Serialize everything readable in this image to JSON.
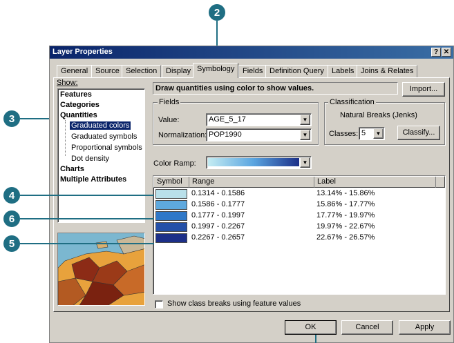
{
  "callouts": {
    "c2": "2",
    "c3": "3",
    "c4": "4",
    "c5": "5",
    "c6": "6"
  },
  "window": {
    "title": "Layer Properties",
    "help_btn": "?",
    "close_btn": "✕"
  },
  "tabs": [
    "General",
    "Source",
    "Selection",
    "Display",
    "Symbology",
    "Fields",
    "Definition Query",
    "Labels",
    "Joins & Relates"
  ],
  "show": {
    "label": "Show:",
    "items": [
      "Features",
      "Categories",
      "Quantities"
    ],
    "sub_items": [
      "Graduated colors",
      "Graduated symbols",
      "Proportional symbols",
      "Dot density"
    ],
    "items_after": [
      "Charts",
      "Multiple Attributes"
    ]
  },
  "heading": "Draw quantities using color to show values.",
  "import_label": "Import...",
  "fields": {
    "group_label": "Fields",
    "value_label": "Value:",
    "value": "AGE_5_17",
    "normalization_label": "Normalization:",
    "normalization": "POP1990"
  },
  "classification": {
    "group_label": "Classification",
    "method": "Natural Breaks (Jenks)",
    "classes_label": "Classes:",
    "classes": "5",
    "classify_label": "Classify..."
  },
  "color_ramp_label": "Color Ramp:",
  "table": {
    "headers": [
      "Symbol",
      "Range",
      "Label"
    ],
    "rows": [
      {
        "range": "0.1314 - 0.1586",
        "label": "13.14% - 15.86%",
        "color": "#b9e0ea"
      },
      {
        "range": "0.1586 - 0.1777",
        "label": "15.86% - 17.77%",
        "color": "#5ea9de"
      },
      {
        "range": "0.1777 - 0.1997",
        "label": "17.77% - 19.97%",
        "color": "#2f78c8"
      },
      {
        "range": "0.1997 - 0.2267",
        "label": "19.97% - 22.67%",
        "color": "#2450a8"
      },
      {
        "range": "0.2267 - 0.2657",
        "label": "22.67% - 26.57%",
        "color": "#1c2f88"
      }
    ]
  },
  "show_breaks_label": "Show class breaks using feature values",
  "buttons": {
    "ok": "OK",
    "cancel": "Cancel",
    "apply": "Apply"
  }
}
